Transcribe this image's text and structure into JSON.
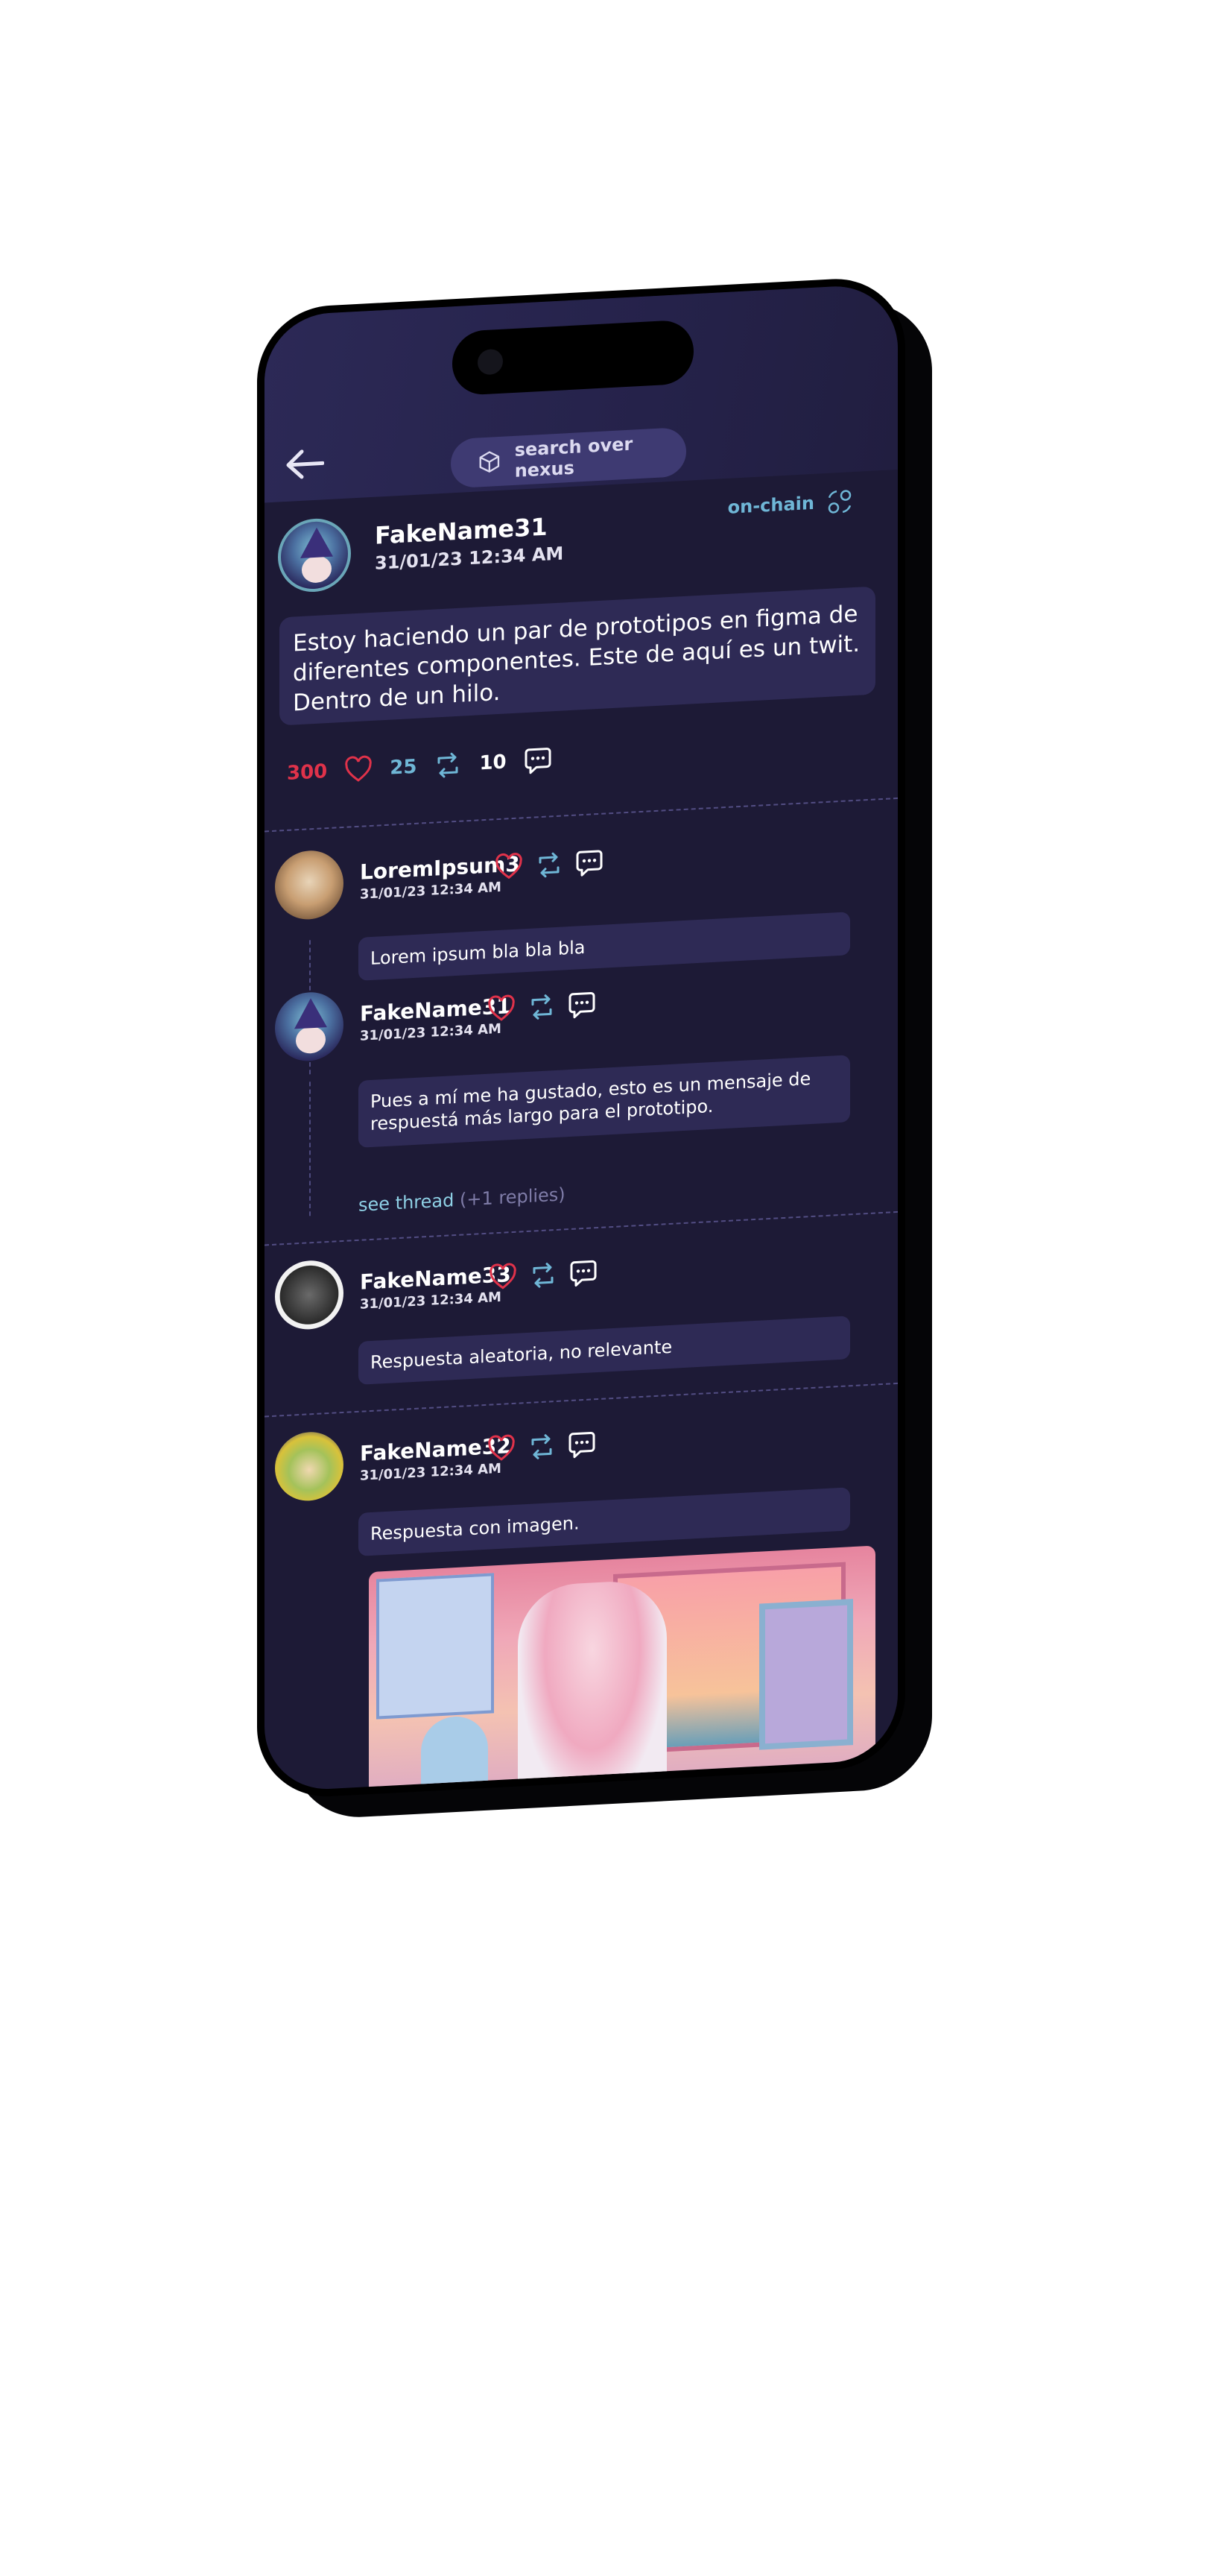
{
  "header": {
    "back_icon": "arrow-left-icon",
    "search_placeholder": "search over nexus",
    "search_icon": "cube-search-icon"
  },
  "post": {
    "author": "FakeName31",
    "date": "31/01/23 12:34 AM",
    "onchain_label": "on-chain",
    "onchain_icon": "chain-nodes-icon",
    "body": "Estoy haciendo un par de prototipos en figma de diferentes componentes. Este de aquí es un twit. Dentro de un hilo.",
    "likes": "300",
    "retweets": "25",
    "replies": "10"
  },
  "replies": [
    {
      "author": "LoremIpsum3",
      "date": "31/01/23 12:34 AM",
      "text": "Lorem ipsum bla bla bla"
    },
    {
      "author": "FakeName31",
      "date": "31/01/23 12:34 AM",
      "text": "Pues a mí me ha gustado, esto es un mensaje de respuestá más largo para el prototipo."
    },
    {
      "author": "FakeName33",
      "date": "31/01/23 12:34 AM",
      "text": "Respuesta aleatoria, no relevante"
    },
    {
      "author": "FakeName32",
      "date": "31/01/23 12:34 AM",
      "text": "Respuesta con imagen."
    }
  ],
  "thread": {
    "see_thread": "see thread",
    "reply_count": "(+1 replies)"
  },
  "colors": {
    "background": "#1d1a36",
    "accent_like": "#e0324a",
    "accent_retweet": "#6fb6d6",
    "bubble": "#2e2a55"
  }
}
